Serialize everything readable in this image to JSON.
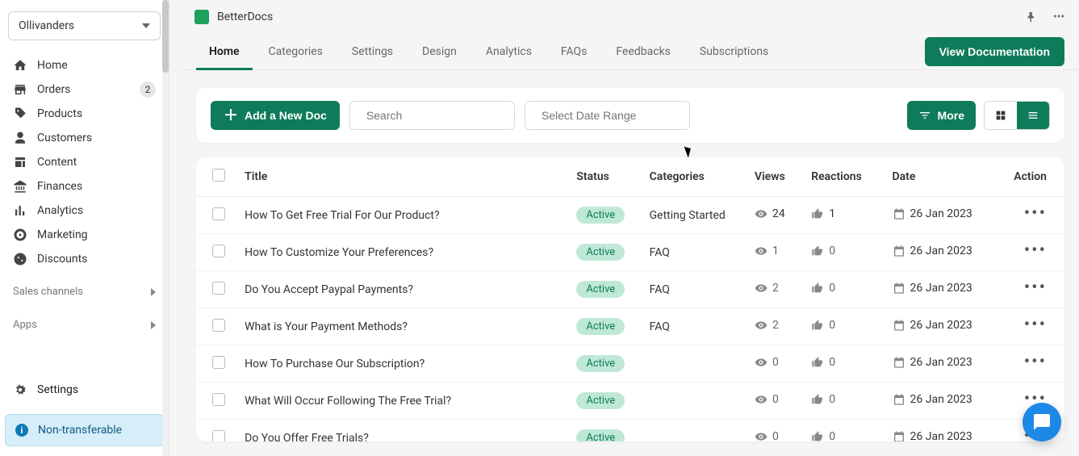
{
  "store_name": "Ollivanders",
  "sidebar": {
    "items": [
      {
        "label": "Home"
      },
      {
        "label": "Orders",
        "badge": "2"
      },
      {
        "label": "Products"
      },
      {
        "label": "Customers"
      },
      {
        "label": "Content"
      },
      {
        "label": "Finances"
      },
      {
        "label": "Analytics"
      },
      {
        "label": "Marketing"
      },
      {
        "label": "Discounts"
      }
    ],
    "sections": [
      {
        "label": "Sales channels"
      },
      {
        "label": "Apps"
      }
    ],
    "settings_label": "Settings",
    "non_transferable_label": "Non-transferable"
  },
  "app": {
    "title": "BetterDocs"
  },
  "tabs": [
    {
      "label": "Home",
      "active": true
    },
    {
      "label": "Categories"
    },
    {
      "label": "Settings"
    },
    {
      "label": "Design"
    },
    {
      "label": "Analytics"
    },
    {
      "label": "FAQs"
    },
    {
      "label": "Feedbacks"
    },
    {
      "label": "Subscriptions"
    }
  ],
  "view_doc_btn": "View Documentation",
  "toolbar": {
    "add_btn": "Add a New Doc",
    "search_placeholder": "Search",
    "date_placeholder": "Select Date Range",
    "more_btn": "More"
  },
  "table": {
    "headers": {
      "title": "Title",
      "status": "Status",
      "categories": "Categories",
      "views": "Views",
      "reactions": "Reactions",
      "date": "Date",
      "action": "Action"
    },
    "rows": [
      {
        "title": "How To Get Free Trial For Our Product?",
        "status": "Active",
        "category": "Getting Started",
        "views": "24",
        "reactions": "1",
        "date": "26 Jan 2023",
        "views_has": true,
        "reactions_has": true
      },
      {
        "title": "How To Customize Your Preferences?",
        "status": "Active",
        "category": "FAQ",
        "views": "1",
        "reactions": "0",
        "date": "26 Jan 2023",
        "views_has": false,
        "reactions_has": false
      },
      {
        "title": "Do You Accept Paypal Payments?",
        "status": "Active",
        "category": "FAQ",
        "views": "2",
        "reactions": "0",
        "date": "26 Jan 2023",
        "views_has": false,
        "reactions_has": false
      },
      {
        "title": "What is Your Payment Methods?",
        "status": "Active",
        "category": "FAQ",
        "views": "2",
        "reactions": "0",
        "date": "26 Jan 2023",
        "views_has": false,
        "reactions_has": false
      },
      {
        "title": "How To Purchase Our Subscription?",
        "status": "Active",
        "category": "",
        "views": "0",
        "reactions": "0",
        "date": "26 Jan 2023",
        "views_has": false,
        "reactions_has": false
      },
      {
        "title": "What Will Occur Following The Free Trial?",
        "status": "Active",
        "category": "",
        "views": "0",
        "reactions": "0",
        "date": "26 Jan 2023",
        "views_has": false,
        "reactions_has": false
      },
      {
        "title": "Do You Offer Free Trials?",
        "status": "Active",
        "category": "",
        "views": "0",
        "reactions": "0",
        "date": "26 Jan 2023",
        "views_has": false,
        "reactions_has": false
      }
    ]
  }
}
